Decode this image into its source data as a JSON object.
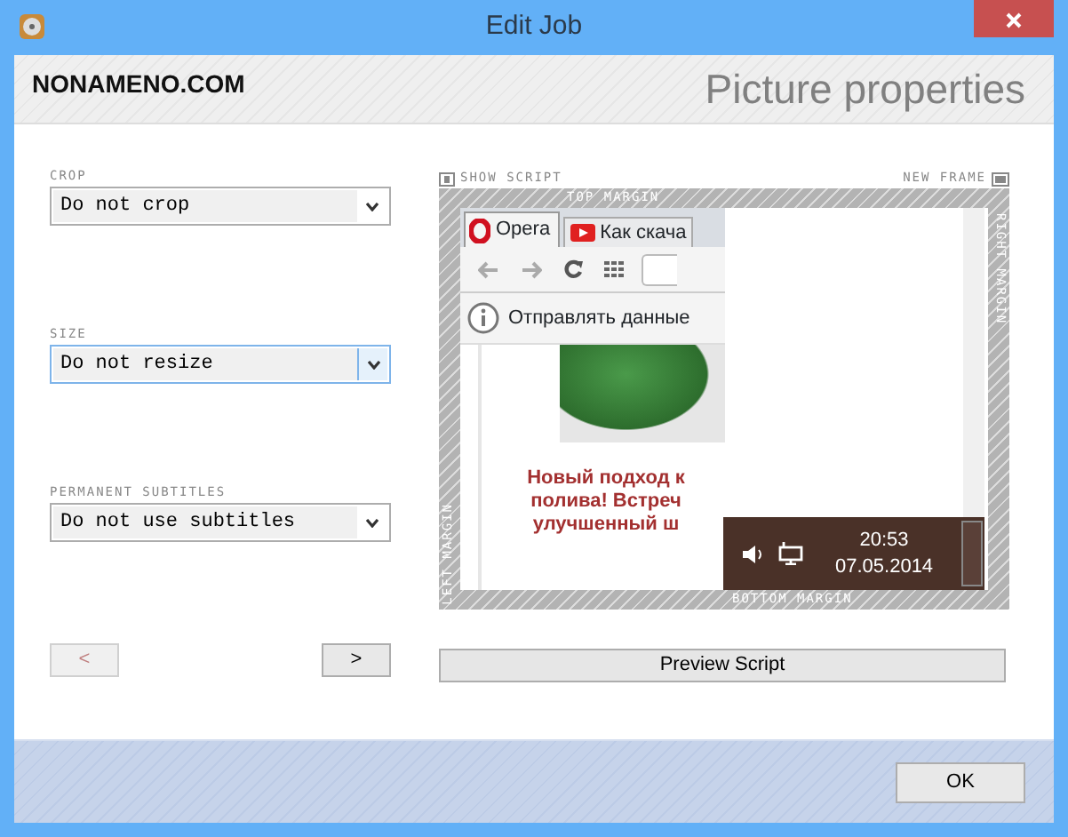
{
  "window": {
    "title": "Edit Job"
  },
  "header": {
    "brand": "NONAMENO.COM",
    "title": "Picture properties"
  },
  "fields": [
    {
      "label": "CROP",
      "value": "Do not crop",
      "focused": false
    },
    {
      "label": "SIZE",
      "value": "Do not resize",
      "focused": true
    },
    {
      "label": "PERMANENT SUBTITLES",
      "value": "Do not use subtitles",
      "focused": false
    }
  ],
  "nav_buttons": [
    {
      "label": "<",
      "disabled": true
    },
    {
      "label": ">",
      "disabled": false
    }
  ],
  "preview": {
    "show_script": "SHOW SCRIPT",
    "new_frame": "NEW FRAME",
    "top_margin": "TOP MARGIN",
    "right_margin": "RIGHT MARGIN",
    "bottom_margin": "BOTTOM MARGIN",
    "left_margin": "LEFT MARGIN",
    "screenshot": {
      "tabs": [
        "Opera",
        "Как скача"
      ],
      "notice": "Отправлять данные",
      "promo_lines": [
        "Новый подход к",
        "полива! Встреч",
        "улучшенный ш"
      ],
      "time": "20:53",
      "date": "07.05.2014"
    }
  },
  "preview_button": "Preview Script",
  "ok_button": "OK"
}
